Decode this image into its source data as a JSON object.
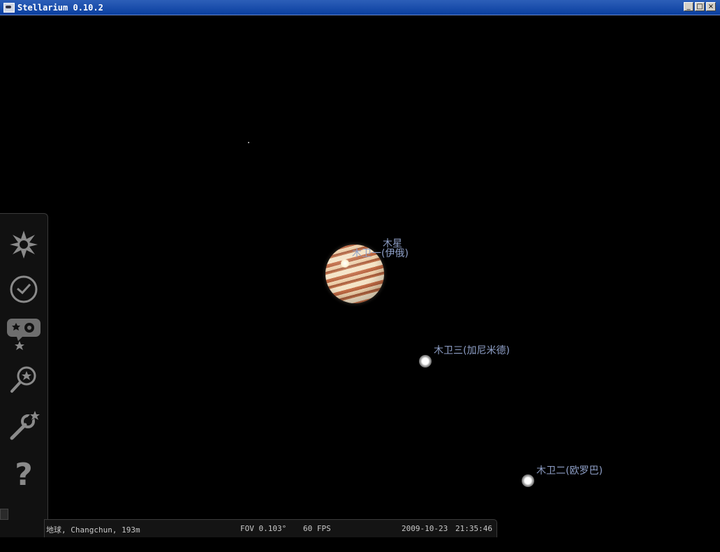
{
  "window": {
    "title": "Stellarium 0.10.2",
    "buttons": {
      "minimize": "_",
      "maximize": "□",
      "close": "×"
    }
  },
  "sky": {
    "planet_label": "木星",
    "moons": [
      {
        "name": "木卫一(伊俄)"
      },
      {
        "name": "木卫三(加尼米德)"
      },
      {
        "name": "木卫二(欧罗巴)"
      }
    ]
  },
  "sidebar": {
    "items": [
      {
        "icon": "location-icon"
      },
      {
        "icon": "clock-icon"
      },
      {
        "icon": "sky-viewing-options-icon"
      },
      {
        "icon": "search-icon"
      },
      {
        "icon": "configuration-icon"
      },
      {
        "icon": "help-icon"
      }
    ]
  },
  "status": {
    "location": "地球, Changchun, 193m",
    "fov": "FOV 0.103°",
    "fps": "60 FPS",
    "date": "2009-10-23",
    "time": "21:35:46"
  },
  "colors": {
    "label": "#8fa0c8",
    "background": "#000000",
    "titlebar": "#0a3fa0"
  }
}
